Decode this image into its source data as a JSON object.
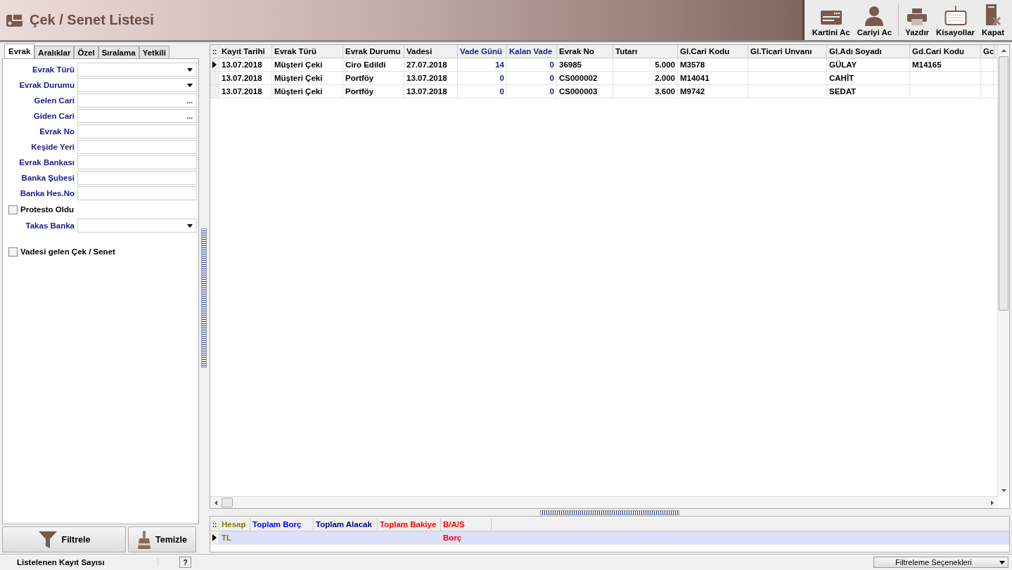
{
  "window": {
    "title": "Çek / Senet Listesi"
  },
  "toolbar": [
    {
      "label": "Kartini Ac",
      "separator_before": false
    },
    {
      "label": "Cariyi Ac",
      "separator_before": false
    },
    {
      "label": "Yazdır",
      "separator_before": true
    },
    {
      "label": "Kisayollar",
      "separator_before": false
    },
    {
      "label": "Kapat",
      "separator_before": false
    }
  ],
  "tabs": [
    {
      "label": "Evrak",
      "selected": true
    },
    {
      "label": "Aralıklar",
      "selected": false
    },
    {
      "label": "Özel",
      "selected": false
    },
    {
      "label": "Sıralama",
      "selected": false
    },
    {
      "label": "Yetkili",
      "selected": false
    }
  ],
  "filters": [
    {
      "kind": "combo",
      "label": "Evrak Türü"
    },
    {
      "kind": "combo",
      "label": "Evrak Durumu"
    },
    {
      "kind": "lookup",
      "label": "Gelen Cari",
      "button": "..."
    },
    {
      "kind": "lookup",
      "label": "Giden Cari",
      "button": "..."
    },
    {
      "kind": "text",
      "label": "Evrak No"
    },
    {
      "kind": "text",
      "label": "Keşide Yeri"
    },
    {
      "kind": "text",
      "label": "Evrak Bankası"
    },
    {
      "kind": "text",
      "label": "Banka Şubesi"
    },
    {
      "kind": "text",
      "label": "Banka Hes.No"
    },
    {
      "kind": "checkbox",
      "label": "Protesto Oldu",
      "checked": false
    },
    {
      "kind": "combo",
      "label": "Takas Banka"
    },
    {
      "kind": "spacer"
    },
    {
      "kind": "checkbox",
      "label": "Vadesi gelen Çek / Senet",
      "checked": false
    }
  ],
  "buttons": [
    {
      "label": "Filtrele"
    },
    {
      "label": "Temizle"
    }
  ],
  "grid": {
    "indicator": "::",
    "columns": [
      {
        "label": "Kayıt Tarihi",
        "color": "#000000"
      },
      {
        "label": "Evrak Türü",
        "color": "#000000"
      },
      {
        "label": "Evrak Durumu",
        "color": "#000000"
      },
      {
        "label": "Vadesi",
        "color": "#000000"
      },
      {
        "label": "Vade Günü",
        "color": "#1a1a8c"
      },
      {
        "label": "Kalan Vade",
        "color": "#1a1a8c"
      },
      {
        "label": "Evrak No",
        "color": "#000000"
      },
      {
        "label": "Tutarı",
        "color": "#000000"
      },
      {
        "label": "Gl.Cari Kodu",
        "color": "#000000"
      },
      {
        "label": "Gl.Ticari Unvanı",
        "color": "#000000"
      },
      {
        "label": "Gl.Adı Soyadı",
        "color": "#000000"
      },
      {
        "label": "Gd.Cari Kodu",
        "color": "#000000"
      },
      {
        "label": "Gc",
        "color": "#000000"
      }
    ],
    "rows": [
      {
        "selected": true,
        "cells": [
          "13.07.2018",
          "Müşteri Çeki",
          "Ciro Edildi",
          "27.07.2018",
          "14",
          "0",
          "36985",
          "5.000",
          "M3578",
          null,
          "GÜLAY",
          "M14165",
          null
        ]
      },
      {
        "selected": false,
        "cells": [
          "13.07.2018",
          "Müşteri Çeki",
          "Portföy",
          "13.07.2018",
          "0",
          "0",
          "CS000002",
          "2.000",
          "M14041",
          null,
          "CAHİT",
          null,
          null
        ]
      },
      {
        "selected": false,
        "cells": [
          "13.07.2018",
          "Müşteri Çeki",
          "Portföy",
          "13.07.2018",
          "0",
          "0",
          "CS000003",
          "3.600",
          "M9742",
          null,
          "SEDAT",
          null,
          null
        ]
      }
    ]
  },
  "summary": {
    "indicator": "::",
    "columns": [
      {
        "label": "Hesap",
        "color": "#808000"
      },
      {
        "label": "Toplam Borç",
        "color": "#0000ff"
      },
      {
        "label": "Toplam Alacak",
        "color": "#000080"
      },
      {
        "label": "Toplam Bakiye",
        "color": "#ff0000"
      },
      {
        "label": "B/A/S",
        "color": "#ff0000"
      }
    ],
    "rows": [
      {
        "selected": true,
        "cells": [
          "TL",
          null,
          null,
          null,
          "Borç"
        ]
      }
    ]
  },
  "status_bar": {
    "label": "Listelenen Kayıt Sayısı",
    "help": "?",
    "options": "Filtreleme Seçenekleri"
  }
}
